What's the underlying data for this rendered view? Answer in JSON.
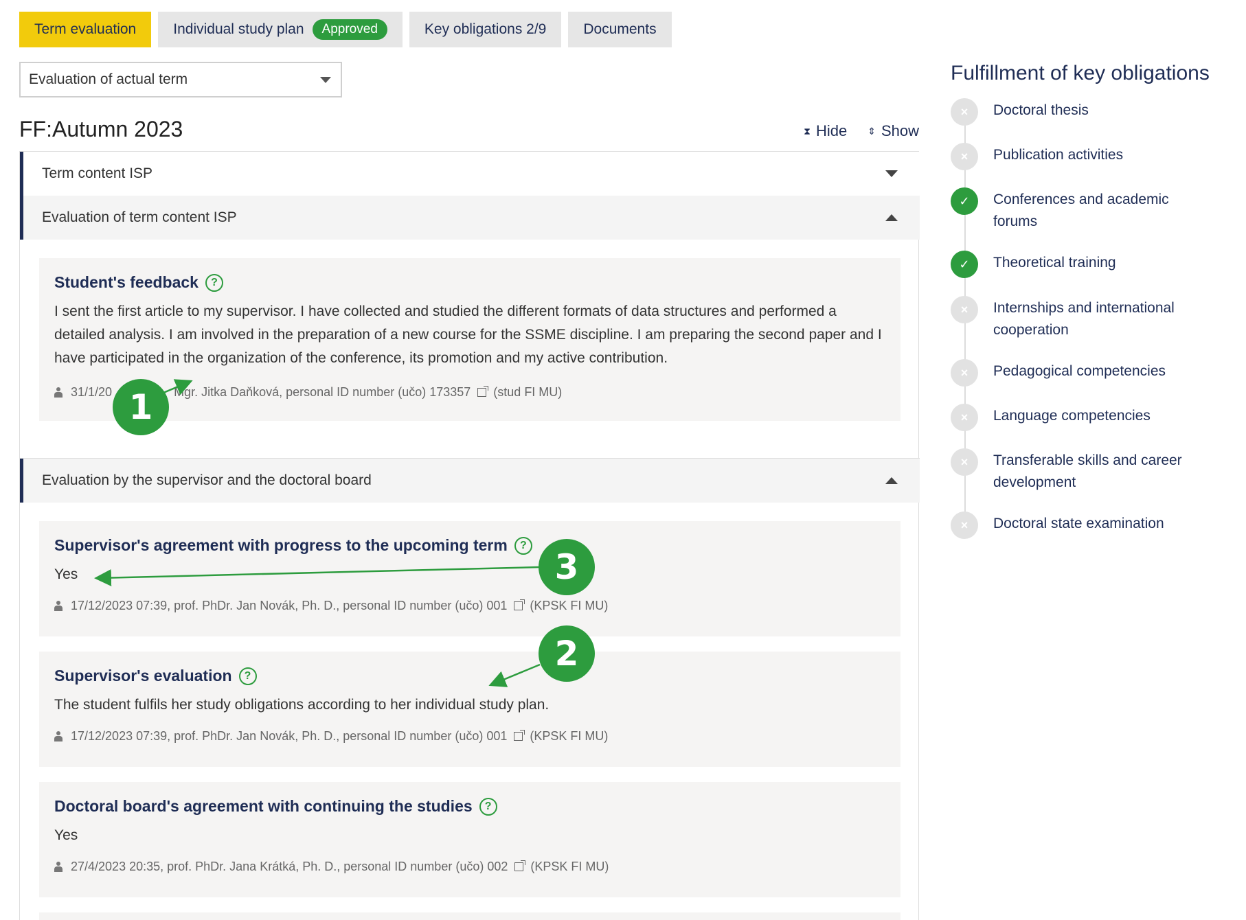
{
  "tabs": [
    {
      "label": "Term evaluation"
    },
    {
      "label": "Individual study plan",
      "badge": "Approved"
    },
    {
      "label": "Key obligations 2/9"
    },
    {
      "label": "Documents"
    }
  ],
  "term_select": {
    "value": "Evaluation of actual term"
  },
  "term_title": "FF:Autumn 2023",
  "controls": {
    "hide": "Hide",
    "show": "Show"
  },
  "sections": {
    "term_content": "Term content ISP",
    "evaluation_content": "Evaluation of term content ISP",
    "supervisor_board": "Evaluation by the supervisor and the doctoral board"
  },
  "cards": {
    "student_feedback": {
      "title": "Student's feedback",
      "text": "I sent the first article to my supervisor. I have collected and studied the different formats of data structures and performed a detailed analysis. I am involved in the preparation of a new course for the SSME discipline. I am preparing the second paper and I have participated in the organization of the conference, its promotion and my active contribution.",
      "meta_date": "31/1/20",
      "meta_person": "Mgr. Jitka Daňková, personal ID number (učo) 173357",
      "meta_org": "(stud FI MU)"
    },
    "supervisor_agreement": {
      "title": "Supervisor's agreement with progress to the upcoming term",
      "text": "Yes",
      "meta_person": "17/12/2023 07:39, prof. PhDr. Jan Novák, Ph. D., personal ID number (učo) 001",
      "meta_org": "(KPSK FI MU)"
    },
    "supervisor_evaluation": {
      "title": "Supervisor's evaluation",
      "text": "The student fulfils her study obligations according to her individual study plan.",
      "meta_person": "17/12/2023 07:39, prof. PhDr. Jan Novák, Ph. D., personal ID number (učo) 001",
      "meta_org": "(KPSK FI MU)"
    },
    "board_agreement": {
      "title": "Doctoral board's agreement with continuing the studies",
      "text": "Yes",
      "meta_person": "27/4/2023 20:35, prof. PhDr. Jana Krátká, Ph. D., personal ID number (učo) 002",
      "meta_org": "(KPSK FI MU)"
    }
  },
  "markers": [
    "1",
    "2",
    "3"
  ],
  "sidebar": {
    "title": "Fulfillment of key obligations",
    "items": [
      {
        "label": "Doctoral thesis",
        "done": false
      },
      {
        "label": "Publication activities",
        "done": false
      },
      {
        "label": "Conferences and academic forums",
        "done": true
      },
      {
        "label": "Theoretical training",
        "done": true
      },
      {
        "label": "Internships and international cooperation",
        "done": false
      },
      {
        "label": "Pedagogical competencies",
        "done": false
      },
      {
        "label": "Language competencies",
        "done": false
      },
      {
        "label": "Transferable skills and career development",
        "done": false
      },
      {
        "label": "Doctoral state examination",
        "done": false
      }
    ]
  },
  "colors": {
    "accent": "#f2cb0c",
    "success": "#2d9c3e",
    "navy": "#1f2d55"
  }
}
